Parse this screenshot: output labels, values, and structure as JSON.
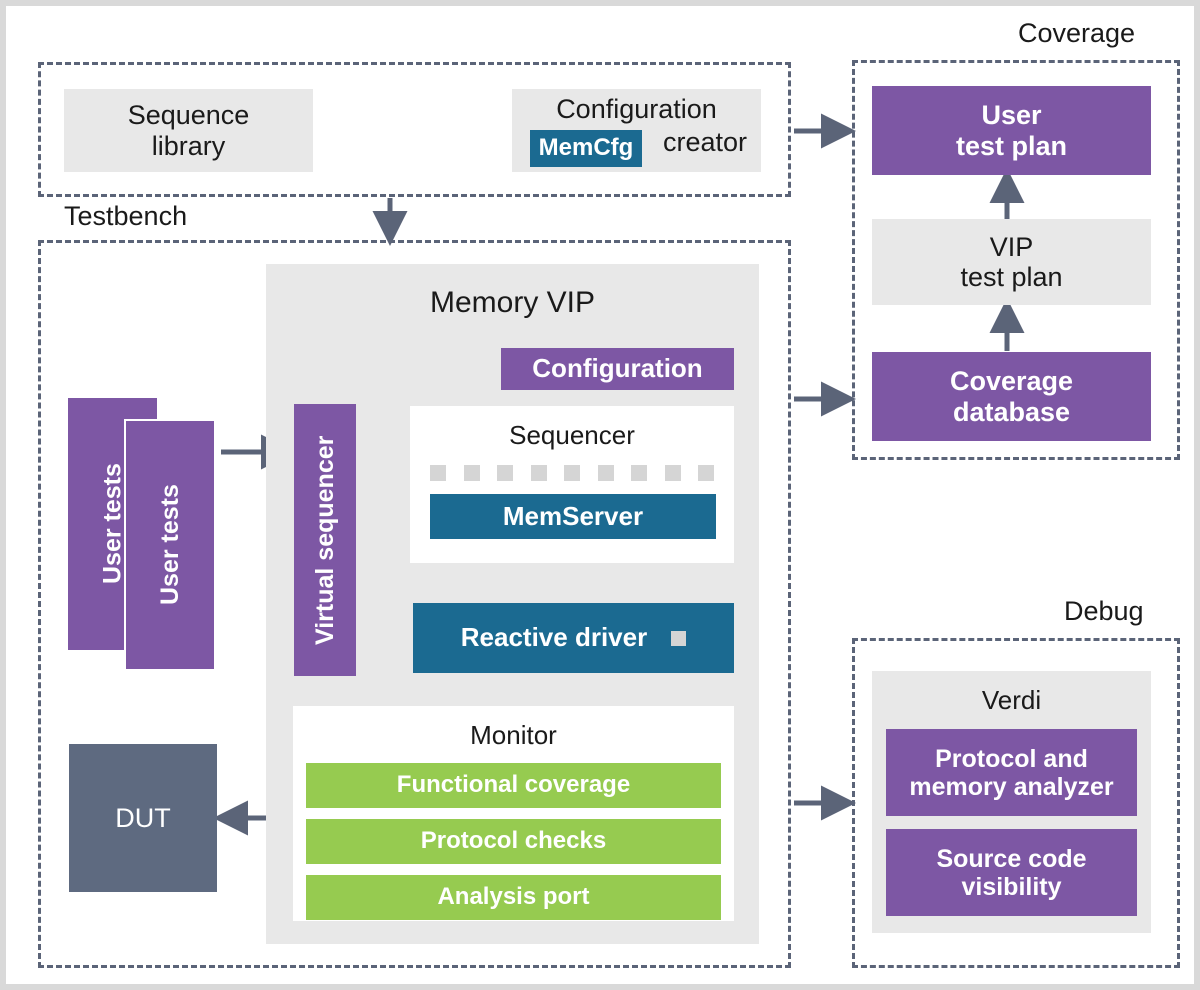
{
  "groups": {
    "testbench": {
      "caption": "Testbench"
    },
    "coverage": {
      "caption": "Coverage"
    },
    "debug": {
      "caption": "Debug"
    }
  },
  "top_row": {
    "sequence_library": "Sequence\nlibrary",
    "configuration_creator": "Configuration\ncreator",
    "memcfg_badge": "MemCfg"
  },
  "testbench": {
    "user_tests_back": "User tests",
    "user_tests_front": "User tests",
    "dut": "DUT",
    "vip": {
      "title": "Memory VIP",
      "configuration": "Configuration",
      "virtual_sequencer": "Virtual sequencer",
      "sequencer": {
        "title": "Sequencer",
        "tick_count": 9,
        "memserver": "MemServer"
      },
      "reactive_driver": "Reactive driver",
      "monitor": {
        "title": "Monitor",
        "items": [
          "Functional coverage",
          "Protocol checks",
          "Analysis port"
        ]
      }
    }
  },
  "coverage": {
    "user_test_plan": "User\ntest plan",
    "vip_test_plan": "VIP\ntest plan",
    "coverage_database": "Coverage\ndatabase"
  },
  "debug": {
    "verdi": "Verdi",
    "items": [
      "Protocol and\nmemory analyzer",
      "Source code\nvisibility"
    ]
  },
  "colors": {
    "purple": "#7d57a4",
    "blue": "#1b6a91",
    "green": "#96cb50",
    "gray_box": "#e8e8e8",
    "dut_gray": "#5e6a80",
    "arrow": "#5b6478",
    "dashed_border": "#5b6478",
    "tick": "#d5d5d5",
    "page_border": "#d9d9d9"
  }
}
